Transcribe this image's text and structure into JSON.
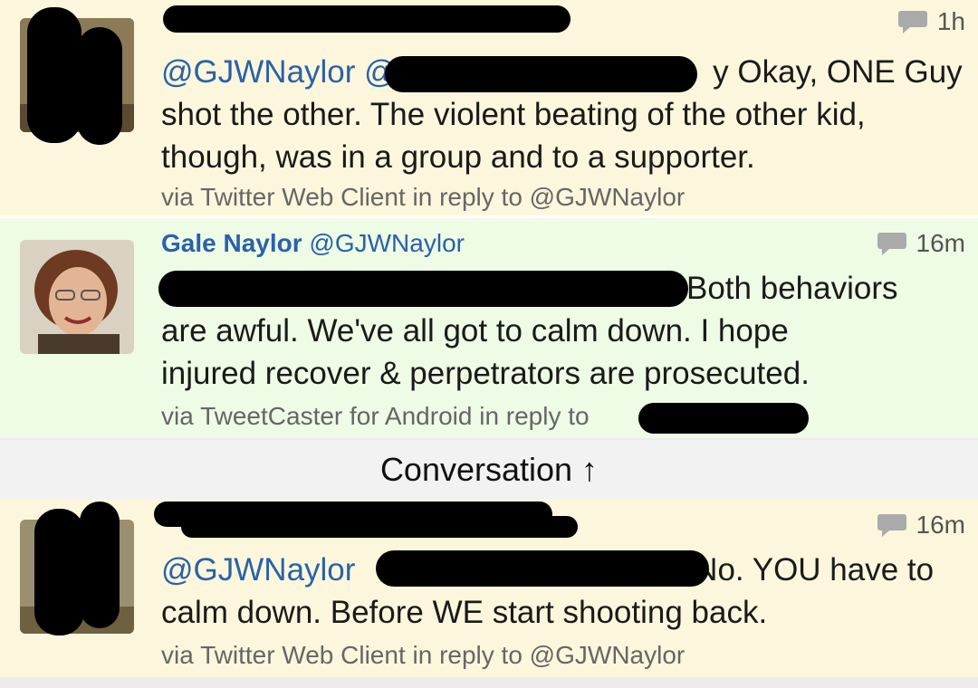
{
  "tweets": [
    {
      "time": "1h",
      "body_lines": [
        "@GJWNaylor @",
        "y Okay, ONE Guy",
        "shot the other. The violent beating of the other kid,",
        "though, was in a group and to a supporter."
      ],
      "via": "via Twitter Web Client in reply to @GJWNaylor"
    },
    {
      "name": "Gale Naylor",
      "handle": "@GJWNaylor",
      "time": "16m",
      "body_lines": [
        "Both behaviors",
        "are awful. We've all got to calm down. I hope",
        "injured recover & perpetrators are prosecuted."
      ],
      "via": "via TweetCaster for Android in reply to"
    },
    {
      "time": "16m",
      "body_lines": [
        "@GJWNaylor",
        "No. YOU have to",
        "calm down. Before WE start shooting back."
      ],
      "via": "via Twitter Web Client in reply to @GJWNaylor"
    }
  ],
  "conversation": {
    "label": "Conversation ↑"
  },
  "icons": {
    "reply_count": "speech-bubble-icon"
  },
  "colors": {
    "mention": "#2a62a8",
    "tweet_yellow": "#fcf7dc",
    "tweet_green": "#eefbe5"
  }
}
